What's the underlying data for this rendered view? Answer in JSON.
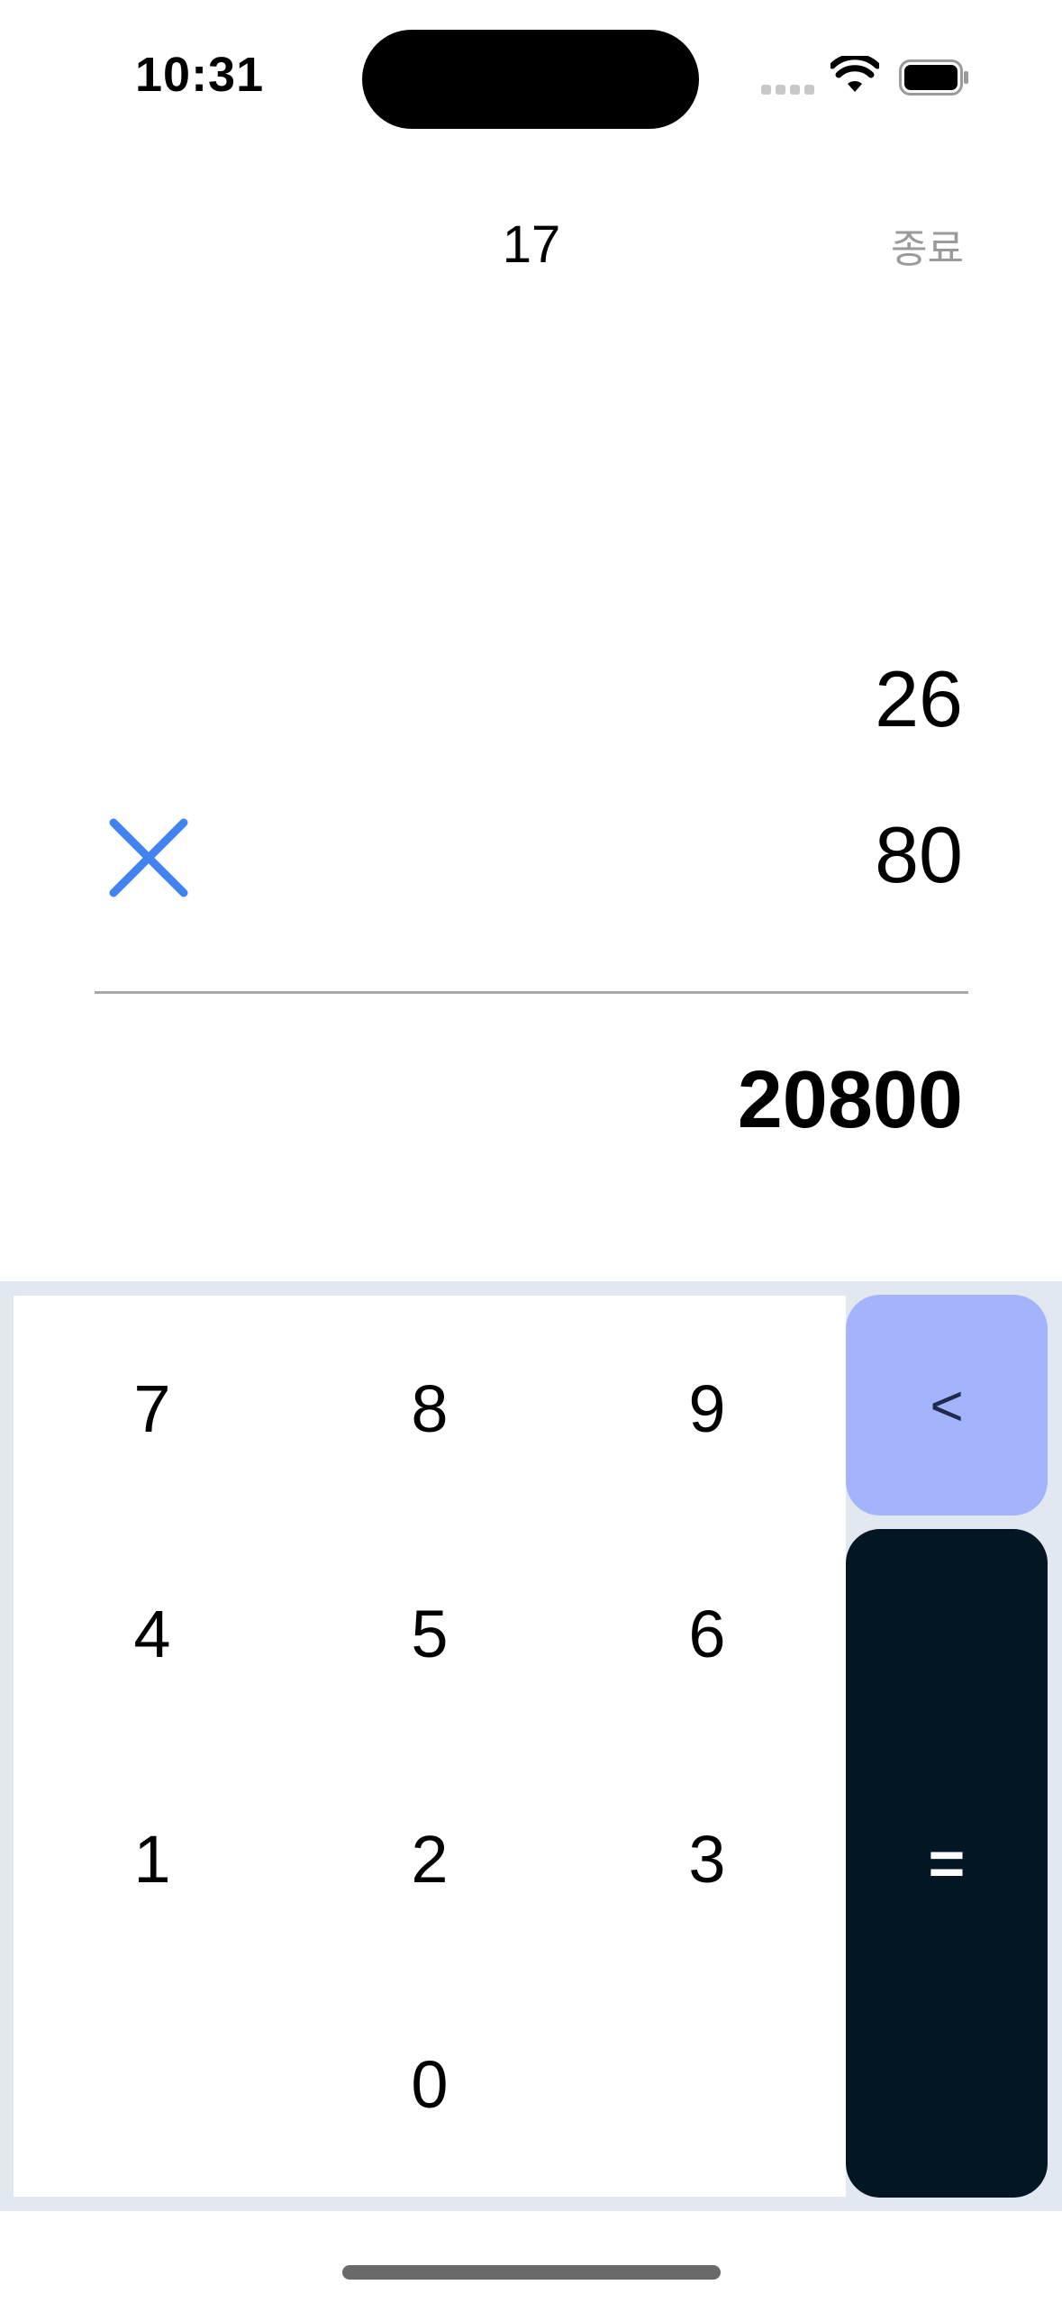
{
  "status_bar": {
    "time": "10:31",
    "icons": [
      "signal-icon",
      "wifi-icon",
      "battery-icon"
    ]
  },
  "header": {
    "counter": "17",
    "end_label": "종료"
  },
  "calculation": {
    "operand1": "26",
    "operator_icon": "multiply-icon",
    "operand2": "80",
    "result": "20800"
  },
  "keypad": {
    "digits": [
      "7",
      "8",
      "9",
      "4",
      "5",
      "6",
      "1",
      "2",
      "3",
      "0"
    ],
    "backspace_label": "<",
    "equals_label": "="
  },
  "colors": {
    "accent_blue": "#3f82f0",
    "backspace_bg": "#a3b4fd",
    "equals_bg": "#031624",
    "keypad_bg": "#e1e8f0"
  }
}
